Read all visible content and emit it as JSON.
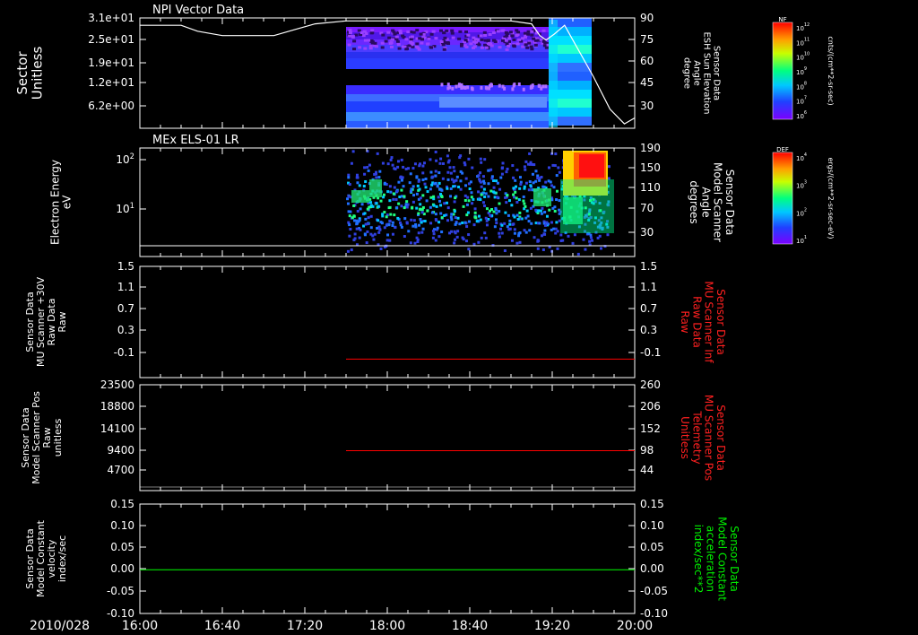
{
  "date_label": "2010/028",
  "x_axis": {
    "ticks": [
      "16:00",
      "16:40",
      "17:20",
      "18:00",
      "18:40",
      "19:20",
      "20:00"
    ],
    "range": [
      "16:00",
      "20:00"
    ]
  },
  "colors": {
    "background": "#000000",
    "axis": "#ffffff",
    "trace_white": "#ffffff",
    "trace_red": "#ff0000",
    "trace_green": "#00ff00",
    "right_label_red": "#ff2020",
    "right_label_green": "#00ee00"
  },
  "panels": [
    {
      "id": "npi",
      "title": "NPI Vector Data",
      "left_label": [
        "Sector",
        "Unitless"
      ],
      "left_ticks": [
        "3.1e+01",
        "2.5e+01",
        "1.9e+01",
        "1.2e+01",
        "6.2e+00"
      ],
      "right_label": [
        "Sensor Data",
        "ESH Sun Elevation",
        "Angle",
        "degree"
      ],
      "right_ticks": [
        "90",
        "75",
        "60",
        "45",
        "30"
      ],
      "colorbar": {
        "title": "NF",
        "ticks": [
          "10^12",
          "10^11",
          "10^10",
          "10^9",
          "10^8",
          "10^7",
          "10^6"
        ],
        "unit": "cnts/(cm**2-sr-sec)"
      }
    },
    {
      "id": "els",
      "title": "MEx ELS-01 LR",
      "left_label": [
        "Electron Energy",
        "eV"
      ],
      "left_ticks": [
        "10^2",
        "10^1"
      ],
      "right_label": [
        "Sensor Data",
        "Model Scanner",
        "Angle",
        "degrees"
      ],
      "right_ticks": [
        "190",
        "150",
        "110",
        "70",
        "30"
      ],
      "colorbar": {
        "title": "DEF",
        "ticks": [
          "10^4",
          "10^3",
          "10^2",
          "10^1"
        ],
        "unit": "ergs/(cm**2-sr-sec-eV)"
      }
    },
    {
      "id": "mu_raw",
      "left_label": [
        "Sensor Data",
        "MU Scanner +30V",
        "Raw Data",
        "Raw"
      ],
      "left_ticks": [
        "1.5",
        "1.1",
        "0.7",
        "0.3",
        "-0.1"
      ],
      "right_label": [
        "Sensor Data",
        "MU Scanner Inf",
        "Raw Data",
        "Raw"
      ],
      "right_ticks": [
        "1.5",
        "1.1",
        "0.7",
        "0.3",
        "-0.1"
      ]
    },
    {
      "id": "scanner_pos",
      "left_label": [
        "Sensor Data",
        "Model Scanner Pos",
        "Raw",
        "unitless"
      ],
      "left_ticks": [
        "23500",
        "18800",
        "14100",
        "9400",
        "4700"
      ],
      "right_label": [
        "Sensor Data",
        "MU Scanner Pos",
        "Telemetry",
        "Unitless"
      ],
      "right_ticks": [
        "260",
        "206",
        "152",
        "98",
        "44"
      ]
    },
    {
      "id": "model_const",
      "left_label": [
        "Sensor Data",
        "Model Constant",
        "velocity",
        "index/sec"
      ],
      "left_ticks": [
        "0.15",
        "0.10",
        "0.05",
        "0.00",
        "-0.05",
        "-0.10"
      ],
      "right_label": [
        "Sensor Data",
        "Model Constant",
        "acceleration",
        "index/sec**2"
      ],
      "right_ticks": [
        "0.15",
        "0.10",
        "0.05",
        "0.00",
        "-0.05",
        "-0.10"
      ]
    }
  ],
  "chart_data": [
    {
      "type": "heatmap",
      "title": "NPI Vector Data",
      "ylabel": "Sector Unitless",
      "x_range": [
        "16:00",
        "20:00"
      ],
      "y_ticks": [
        31,
        25,
        19,
        12,
        6.2
      ],
      "data_start": "17:40",
      "overlay_line": {
        "name": "ESH Sun Elevation Angle",
        "ylim": [
          15,
          90
        ],
        "x": [
          "16:00",
          "16:20",
          "16:28",
          "16:40",
          "17:05",
          "17:15",
          "17:25",
          "17:40",
          "18:00",
          "18:20",
          "18:40",
          "19:00",
          "19:10",
          "19:14",
          "19:17",
          "19:21",
          "19:26",
          "19:32",
          "19:40",
          "19:48",
          "19:55",
          "20:00"
        ],
        "y": [
          85,
          85,
          81,
          78,
          78,
          82,
          86,
          88,
          88,
          88,
          88,
          88,
          86,
          78,
          75,
          79,
          85,
          70,
          50,
          28,
          18,
          22
        ]
      }
    },
    {
      "type": "heatmap",
      "title": "MEx ELS-01 LR",
      "ylabel": "Electron Energy eV",
      "yscale": "log",
      "x_range": [
        "16:00",
        "20:00"
      ],
      "data_start": "17:40"
    },
    {
      "type": "line",
      "ylabel": "MU Scanner +30V Raw Data",
      "ylim": [
        -0.3,
        1.5
      ],
      "series": [
        {
          "color": "#ff0000",
          "x": [
            "17:40",
            "20:00"
          ],
          "y": [
            0,
            0
          ]
        }
      ]
    },
    {
      "type": "line",
      "ylabel": "Model Scanner Pos Raw unitless",
      "right_ylim": [
        0,
        260
      ],
      "series": [
        {
          "color": "#ff0000",
          "x": [
            "17:40",
            "20:00"
          ],
          "y_right": [
            98,
            98
          ]
        }
      ]
    },
    {
      "type": "line",
      "ylabel": "Model Constant velocity index/sec",
      "ylim": [
        -0.1,
        0.15
      ],
      "series": [
        {
          "color": "#00ff00",
          "x": [
            "16:00",
            "20:00"
          ],
          "y": [
            0,
            0
          ]
        }
      ]
    }
  ]
}
